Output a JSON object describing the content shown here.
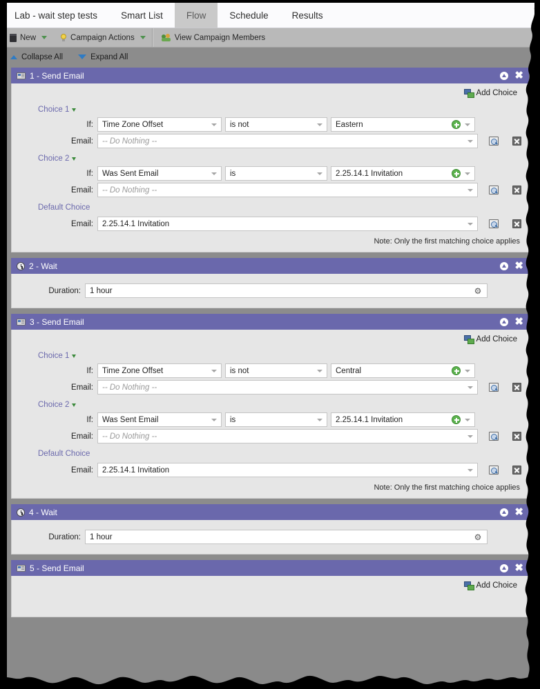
{
  "tabs": [
    {
      "label": "Lab - wait step tests",
      "active": false
    },
    {
      "label": "Smart List",
      "active": false
    },
    {
      "label": "Flow",
      "active": true
    },
    {
      "label": "Schedule",
      "active": false
    },
    {
      "label": "Results",
      "active": false
    }
  ],
  "actionbar": {
    "new_label": "New",
    "campaign_actions_label": "Campaign Actions",
    "view_members_label": "View Campaign Members",
    "new_icon": "trashcan-icon",
    "campaign_actions_icon": "lightbulb-icon",
    "view_members_icon": "people-icon"
  },
  "collapse_bar": {
    "collapse_all": "Collapse All",
    "expand_all": "Expand All"
  },
  "labels": {
    "if": "If:",
    "email": "Email:",
    "duration": "Duration:",
    "add_choice": "Add Choice",
    "default_choice": "Default Choice",
    "note": "Note: Only the first matching choice applies"
  },
  "colors": {
    "step_header": "#6a68ac",
    "choice_link": "#6a68ac",
    "canvas": "#8c8c8c",
    "panel_body": "#e6e6e6",
    "accent_green": "#5cb34e",
    "triangle_blue": "#2e7bc4"
  },
  "steps": [
    {
      "title": "1 - Send Email",
      "type": "send-email",
      "icon": "email-icon",
      "choices": [
        {
          "label": "Choice 1",
          "if_attribute": "Time Zone Offset",
          "operator": "is not",
          "value": "Eastern",
          "email": "-- Do Nothing --",
          "email_is_placeholder": true
        },
        {
          "label": "Choice 2",
          "if_attribute": "Was Sent Email",
          "operator": "is",
          "value": "2.25.14.1 Invitation",
          "email": "-- Do Nothing --",
          "email_is_placeholder": true
        }
      ],
      "default_choice": {
        "label": "Default Choice",
        "email": "2.25.14.1 Invitation",
        "email_is_placeholder": false
      },
      "note": "Note: Only the first matching choice applies"
    },
    {
      "title": "2 - Wait",
      "type": "wait",
      "icon": "clock-icon",
      "duration": "1 hour"
    },
    {
      "title": "3 - Send Email",
      "type": "send-email",
      "icon": "email-icon",
      "choices": [
        {
          "label": "Choice 1",
          "if_attribute": "Time Zone Offset",
          "operator": "is not",
          "value": "Central",
          "email": "-- Do Nothing --",
          "email_is_placeholder": true
        },
        {
          "label": "Choice 2",
          "if_attribute": "Was Sent Email",
          "operator": "is",
          "value": "2.25.14.1 Invitation",
          "email": "-- Do Nothing --",
          "email_is_placeholder": true
        }
      ],
      "default_choice": {
        "label": "Default Choice",
        "email": "2.25.14.1 Invitation",
        "email_is_placeholder": false
      },
      "note": "Note: Only the first matching choice applies"
    },
    {
      "title": "4 - Wait",
      "type": "wait",
      "icon": "clock-icon",
      "duration": "1 hour"
    },
    {
      "title": "5 - Send Email",
      "type": "send-email-partial",
      "icon": "email-icon",
      "choices": [],
      "note": ""
    }
  ]
}
